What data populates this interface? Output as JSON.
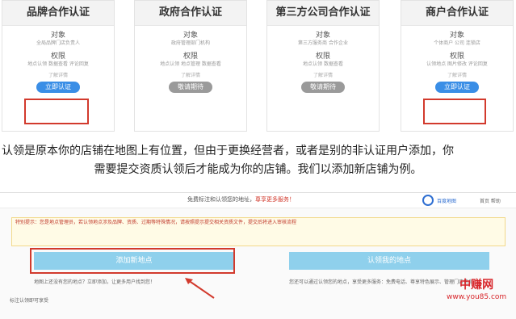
{
  "cards": [
    {
      "title": "品牌合作认证",
      "sub1": "对象",
      "blur1": "全局品牌门店负责人",
      "sub2": "权限",
      "blur2": "地点认领 数据查看 评论回复",
      "link": "了解详情",
      "button": "立即认证",
      "button_style": "active"
    },
    {
      "title": "政府合作认证",
      "sub1": "对象",
      "blur1": "政府管理部门机构",
      "sub2": "权限",
      "blur2": "地点认领 地点管理 数据查看",
      "link": "了解详情",
      "button": "敬请期待",
      "button_style": "disabled"
    },
    {
      "title": "第三方公司合作认证",
      "sub1": "对象",
      "blur1": "第三方服务商 合作企业",
      "sub2": "权限",
      "blur2": "地点认领 数据查看",
      "link": "了解详情",
      "button": "敬请期待",
      "button_style": "disabled"
    },
    {
      "title": "商户合作认证",
      "sub1": "对象",
      "blur1": "个体商户 公司 连锁店",
      "sub2": "权限",
      "blur2": "认领地点 图片修改 评论回复",
      "link": "了解详情",
      "button": "立即认证",
      "button_style": "active"
    }
  ],
  "paragraph": {
    "line1": "认领是原本你的店铺在地图上有位置，但由于更换经营者，或者是别的非认证用户添加，你",
    "line2": "需要提交资质认领后才能成为你的店铺。我们以添加新店铺为例。"
  },
  "screenshot": {
    "notice_left": "免费标注和认领您的地址，",
    "notice_red": "尊享更多服务！",
    "logo_text": "百度地图",
    "links": "首页 帮助",
    "warning": "特别提示：您是地点管理员，若认领地点涉及品牌、资质、过期等特殊情况，请按照提示提交相关资质文件，提交后将进入审核流程",
    "add_button": "添加新地点",
    "claim_button": "认领我的地点",
    "left_note": "地图上还没有您的地点？立即添加，让更多用户找到您！",
    "right_note": "您还可以通过认领您的地点，享受更多服务：免费电话、尊享特色展示、管理门店信息",
    "bottom_note": "标注认领即可享受"
  },
  "watermark": {
    "line1": "中赚网",
    "line2": "www.you85.com"
  },
  "colors": {
    "accent_blue": "#3a8ee6",
    "highlight_red": "#d23a2d",
    "light_blue_btn": "#8fd0ec",
    "watermark_red": "#d8262b"
  }
}
